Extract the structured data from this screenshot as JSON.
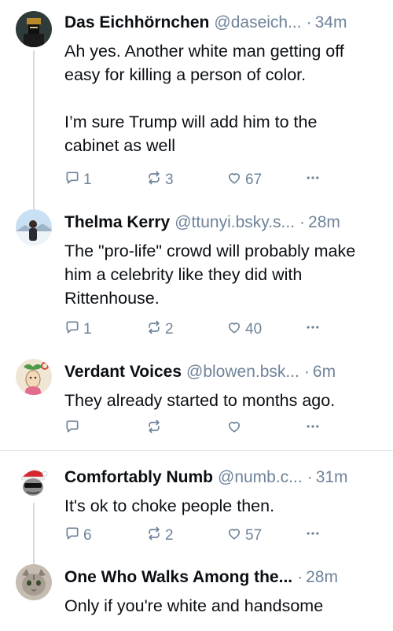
{
  "colors": {
    "text": "#0b0f14",
    "muted": "#6f839a",
    "thread_line": "#d4dbe2",
    "divider": "#e2e7ec"
  },
  "posts": [
    {
      "name": "Das Eichhörnchen",
      "handle": "@daseich...",
      "sep": "·",
      "time": "34m",
      "text": "Ah yes. Another white man getting off easy for killing a person of color.\n\nI’m sure Trump will add him to the cabinet as well",
      "replies": "1",
      "reposts": "3",
      "likes": "67",
      "icons": {
        "reply": "reply-icon",
        "repost": "repost-icon",
        "like": "heart-icon",
        "more": "more-icon"
      }
    },
    {
      "name": "Thelma Kerry",
      "handle": "@ttunyi.bsky.s...",
      "sep": "·",
      "time": "28m",
      "text": "The \"pro-life\" crowd will probably make him a celebrity like they did with Rittenhouse.",
      "replies": "1",
      "reposts": "2",
      "likes": "40"
    },
    {
      "name": "Verdant Voices",
      "handle": "@blowen.bsk...",
      "sep": "·",
      "time": "6m",
      "text": "They already started to months ago.",
      "replies": "",
      "reposts": "",
      "likes": ""
    },
    {
      "name": "Comfortably Numb",
      "handle": "@numb.c...",
      "sep": "·",
      "time": "31m",
      "text": "It's ok to choke people then.",
      "replies": "6",
      "reposts": "2",
      "likes": "57"
    },
    {
      "name": "One Who Walks Among the...",
      "handle": "",
      "sep": "·",
      "time": "28m",
      "text": "Only if you're white and handsome"
    }
  ]
}
